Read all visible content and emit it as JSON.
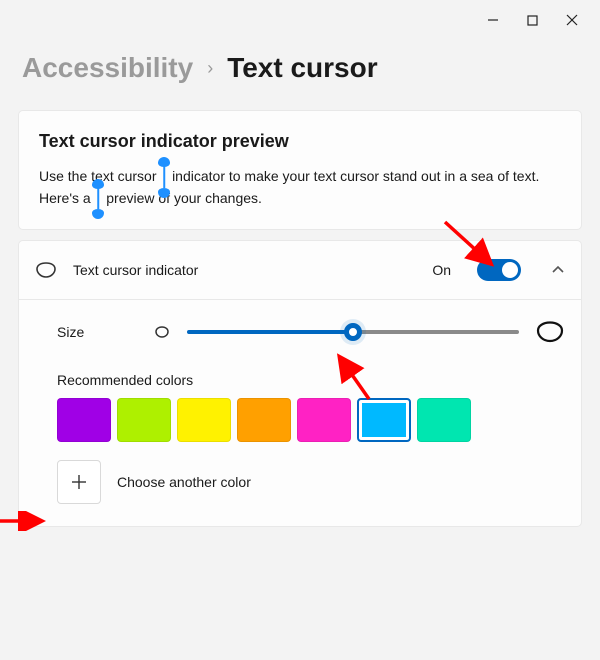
{
  "window_controls": {
    "minimize": "—",
    "maximize": "▢",
    "close": "✕"
  },
  "breadcrumb": {
    "previous": "Accessibility",
    "separator": "›",
    "current": "Text cursor"
  },
  "preview": {
    "title": "Text cursor indicator preview",
    "description_a": "Use the text cursor",
    "description_b": "indicator to make your text cursor stand out in a sea of text. Here's a",
    "description_c": "preview of your changes."
  },
  "indicator": {
    "label": "Text cursor indicator",
    "state": "On"
  },
  "size": {
    "label": "Size",
    "value_percent": 50
  },
  "colors": {
    "label": "Recommended colors",
    "items": [
      {
        "hex": "#a000e6",
        "selected": false
      },
      {
        "hex": "#aef000",
        "selected": false
      },
      {
        "hex": "#fff200",
        "selected": false
      },
      {
        "hex": "#ffa000",
        "selected": false
      },
      {
        "hex": "#ff22c4",
        "selected": false
      },
      {
        "hex": "#00b9ff",
        "selected": true
      },
      {
        "hex": "#00e6b0",
        "selected": false
      }
    ],
    "choose_label": "Choose another color"
  },
  "annotations": {
    "arrow_color": "#ff0000"
  }
}
